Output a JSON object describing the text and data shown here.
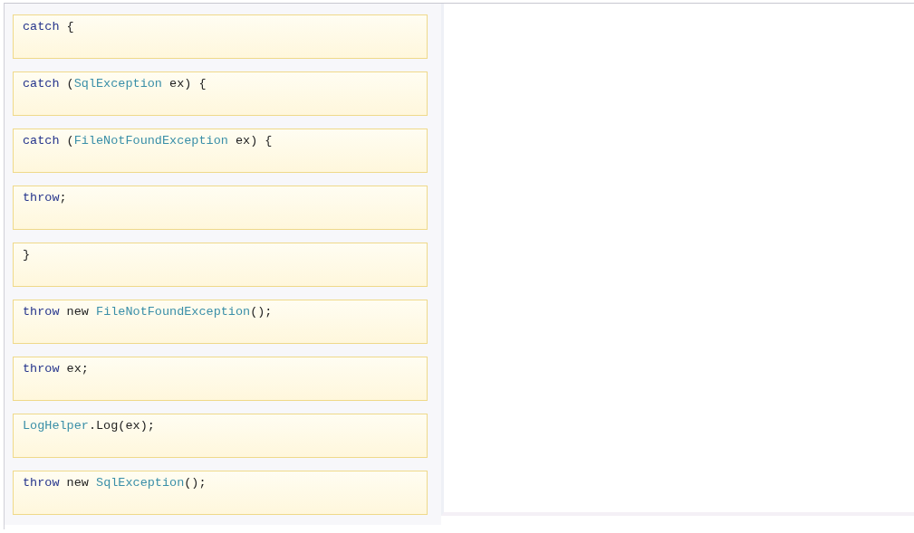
{
  "code_tiles": [
    {
      "tokens": [
        {
          "text": "catch",
          "kind": "keyword"
        },
        {
          "text": " {",
          "kind": "plain"
        }
      ]
    },
    {
      "tokens": [
        {
          "text": "catch",
          "kind": "keyword"
        },
        {
          "text": " (",
          "kind": "plain"
        },
        {
          "text": "SqlException",
          "kind": "type"
        },
        {
          "text": " ex) {",
          "kind": "plain"
        }
      ]
    },
    {
      "tokens": [
        {
          "text": "catch",
          "kind": "keyword"
        },
        {
          "text": " (",
          "kind": "plain"
        },
        {
          "text": "FileNotFoundException",
          "kind": "type"
        },
        {
          "text": " ex) {",
          "kind": "plain"
        }
      ]
    },
    {
      "tokens": [
        {
          "text": "throw",
          "kind": "keyword"
        },
        {
          "text": ";",
          "kind": "plain"
        }
      ]
    },
    {
      "tokens": [
        {
          "text": "}",
          "kind": "plain"
        }
      ]
    },
    {
      "tokens": [
        {
          "text": "throw",
          "kind": "keyword"
        },
        {
          "text": " new ",
          "kind": "plain"
        },
        {
          "text": "FileNotFoundException",
          "kind": "type"
        },
        {
          "text": "();",
          "kind": "plain"
        }
      ]
    },
    {
      "tokens": [
        {
          "text": "throw",
          "kind": "keyword"
        },
        {
          "text": " ex;",
          "kind": "plain"
        }
      ]
    },
    {
      "tokens": [
        {
          "text": "LogHelper",
          "kind": "type"
        },
        {
          "text": ".Log(ex);",
          "kind": "plain"
        }
      ]
    },
    {
      "tokens": [
        {
          "text": "throw",
          "kind": "keyword"
        },
        {
          "text": " new ",
          "kind": "plain"
        },
        {
          "text": "SqlException",
          "kind": "type"
        },
        {
          "text": "();",
          "kind": "plain"
        }
      ]
    }
  ]
}
